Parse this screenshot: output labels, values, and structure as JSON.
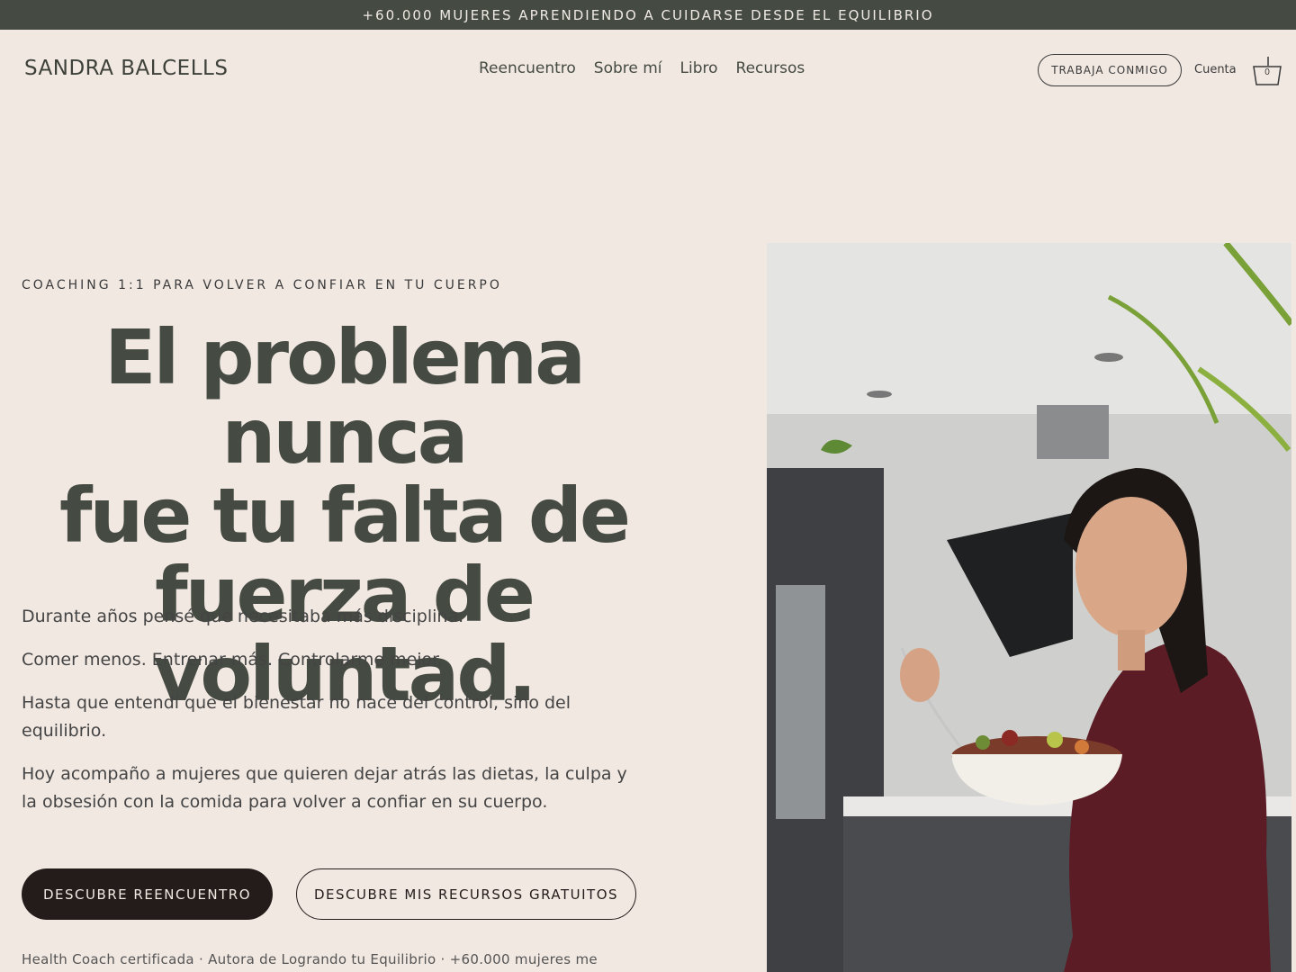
{
  "announcement": "+60.000 MUJERES APRENDIENDO A CUIDARSE DESDE EL EQUILIBRIO",
  "brand": {
    "logo_text": "SANDRA BALCELLS"
  },
  "nav": {
    "items": [
      {
        "label": "Reencuentro"
      },
      {
        "label": "Sobre mí"
      },
      {
        "label": "Libro"
      },
      {
        "label": "Recursos"
      }
    ]
  },
  "header": {
    "cta_label": "TRABAJA CONMIGO",
    "account_label": "Cuenta",
    "cart_count": "0"
  },
  "hero": {
    "eyebrow": "COACHING 1:1 PARA VOLVER A CONFIAR EN TU CUERPO",
    "headline_lines": [
      "El problema nunca",
      "fue tu falta de",
      "fuerza de voluntad."
    ],
    "paragraphs": [
      "Durante años pensé que necesitaba más disciplina.",
      "Comer menos. Entrenar más. Controlarme mejor.",
      "Hasta que entendí que el bienestar no nace del control, sino del equilibrio.",
      "Hoy acompaño a mujeres que quieren dejar atrás las dietas, la culpa y la obsesión con la comida para volver a confiar en su cuerpo."
    ],
    "primary_button": "DESCUBRE REENCUENTRO",
    "secondary_button": "DESCUBRE MIS RECURSOS GRATUITOS",
    "credentials": "Health Coach certificada · Autora de Logrando tu Equilibrio · +60.000 mujeres me"
  },
  "colors": {
    "background": "#f1e8e2",
    "announcement_bar": "#454b42",
    "headline": "#454b42",
    "button_dark": "#231c1a"
  }
}
